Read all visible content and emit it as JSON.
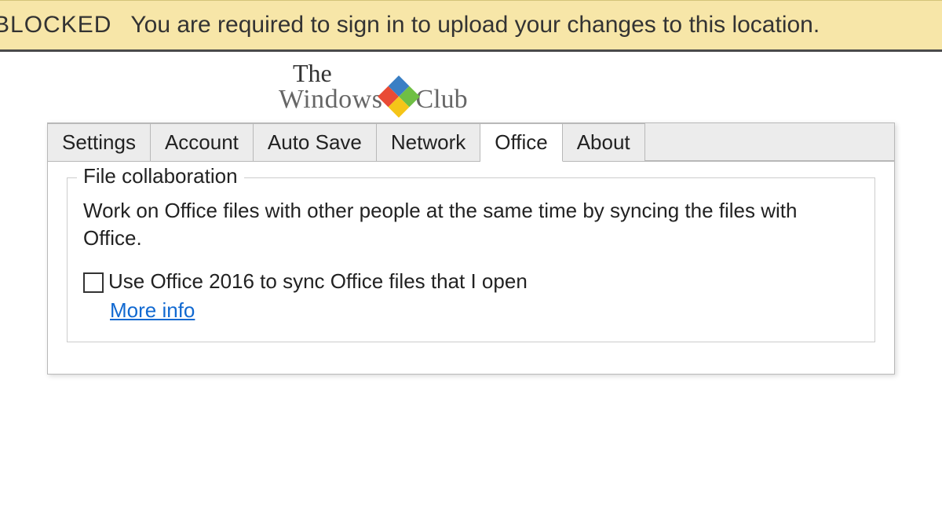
{
  "notification": {
    "title": "D BLOCKED",
    "message": "You are required to sign in to upload your changes to this location."
  },
  "watermark": {
    "line1": "The",
    "line2a": "Windows",
    "line2b": "Club"
  },
  "tabs": [
    {
      "label": "Settings",
      "active": false
    },
    {
      "label": "Account",
      "active": false
    },
    {
      "label": "Auto Save",
      "active": false
    },
    {
      "label": "Network",
      "active": false
    },
    {
      "label": "Office",
      "active": true
    },
    {
      "label": "About",
      "active": false
    }
  ],
  "fieldset": {
    "legend": "File collaboration",
    "description": "Work on Office files with other people at the same time by syncing the files with Office.",
    "checkbox_label": "Use Office 2016 to sync Office files that I open",
    "more_info": "More info"
  }
}
